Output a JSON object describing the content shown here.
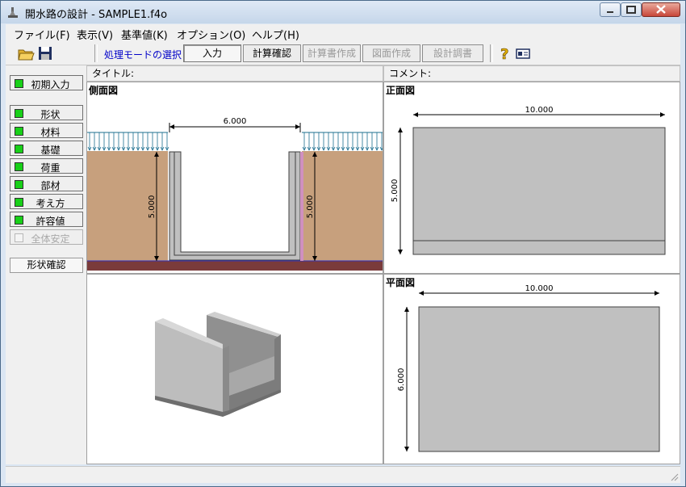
{
  "window": {
    "title": "開水路の設計 - SAMPLE1.f4o"
  },
  "menu": [
    "ファイル(F)",
    "表示(V)",
    "基準値(K)",
    "オプション(O)",
    "ヘルプ(H)"
  ],
  "toolbar": {
    "mode_label": "処理モードの選択",
    "modes": [
      {
        "label": "入力",
        "state": "active"
      },
      {
        "label": "計算確認",
        "state": "enabled"
      },
      {
        "label": "計算書作成",
        "state": "disabled"
      },
      {
        "label": "図面作成",
        "state": "disabled"
      },
      {
        "label": "設計調書",
        "state": "disabled"
      }
    ]
  },
  "left_panel": {
    "initial_input": "初期入力",
    "items": [
      {
        "label": "形状",
        "state": "enabled"
      },
      {
        "label": "材料",
        "state": "enabled"
      },
      {
        "label": "基礎",
        "state": "enabled"
      },
      {
        "label": "荷重",
        "state": "enabled"
      },
      {
        "label": "部材",
        "state": "enabled"
      },
      {
        "label": "考え方",
        "state": "enabled"
      },
      {
        "label": "許容値",
        "state": "enabled"
      },
      {
        "label": "全体安定",
        "state": "disabled"
      }
    ],
    "shape_check": "形状確認"
  },
  "header": {
    "title_label": "タイトル:",
    "comment_label": "コメント:"
  },
  "views": {
    "side": {
      "title": "側面図",
      "width_dim": "6.000",
      "left_height_dim": "5.000",
      "right_height_dim": "5.000"
    },
    "front": {
      "title": "正面図",
      "width_dim": "10.000",
      "height_dim": "5.000"
    },
    "plan": {
      "title": "平面図",
      "width_dim": "10.000",
      "height_dim": "6.000"
    }
  },
  "colors": {
    "soil": "#c7a07d",
    "base": "#7a3b3b",
    "concrete": "#c0c0c0",
    "load_arrow": "#1d6f8f",
    "mode_label": "#0000c8"
  }
}
